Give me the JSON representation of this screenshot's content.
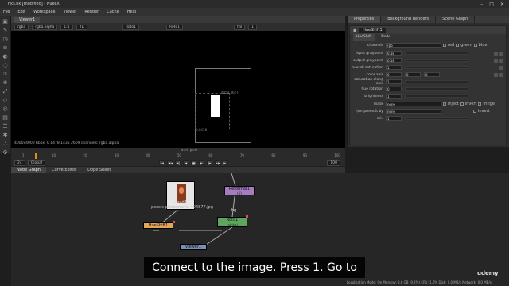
{
  "window": {
    "title": "nks.nk [modified] - NukeX",
    "controls": [
      "–",
      "□",
      "✕"
    ]
  },
  "menu": [
    "File",
    "Edit",
    "Workspace",
    "Viewer",
    "Render",
    "Cache",
    "Help"
  ],
  "viewer": {
    "tab_label": "Viewer1",
    "channels": "rgba",
    "channel_alpha": "rgba.alpha",
    "zoom": "1:1",
    "proxy": "2D",
    "input_a": "Roto1",
    "input_b": "Roto1",
    "gain": "f/8",
    "gamma": "1",
    "status_line": "4000x4000  bbox: 0 1478 1435 2609 channels: rgba.alpha",
    "coords": "x=0 y=0",
    "bbox_top_label": "4054,4627",
    "bbox_bottom_label": "0,0478"
  },
  "properties": {
    "tabs": [
      "Properties",
      "Background Renders",
      "Scene Graph"
    ],
    "node_name": "HueShift1",
    "node_tab_active": "HueShift",
    "node_tab_other": "Node",
    "rows": [
      {
        "label": "channels",
        "value": "rgb"
      },
      {
        "label": "input graypoint",
        "value": "0.18"
      },
      {
        "label": "output graypoint",
        "value": "0.18"
      },
      {
        "label": "overall saturation",
        "value": "1"
      },
      {
        "label": "color axis",
        "value": "0"
      },
      {
        "label": "saturation along axis",
        "value": "1"
      },
      {
        "label": "hue rotation",
        "value": "0"
      },
      {
        "label": "brightness",
        "value": "1"
      },
      {
        "label": "mask",
        "value": "none"
      },
      {
        "label": "(un)premult by",
        "value": "none"
      },
      {
        "label": "mix",
        "value": "1"
      }
    ],
    "channel_checks": [
      "red",
      "green",
      "blue"
    ],
    "mask_opts": [
      "inject",
      "invert",
      "fringe"
    ],
    "premult_opt": "invert"
  },
  "timeline": {
    "ticks": [
      "1",
      "10",
      "20",
      "30",
      "40",
      "50",
      "60",
      "70",
      "80",
      "90",
      "100"
    ],
    "current_frame": "24",
    "fps_label": "Global",
    "end_frame": "100",
    "buttons": [
      "|◀",
      "◀◀",
      "◀|",
      "◀",
      "■",
      "▶",
      "|▶",
      "▶▶",
      "▶|"
    ]
  },
  "dag": {
    "tabs": [
      "Node Graph",
      "Curve Editor",
      "Dope Sheet"
    ],
    "nodes": {
      "read": {
        "label": "Read1",
        "sub": "pexels-photomania-494877.jpg"
      },
      "reformat": {
        "label": "Reformat1",
        "sub": "(1)"
      },
      "roto": {
        "label": "Roto1",
        "sub": "(alpha)"
      },
      "hueshift": {
        "label": "HueShift1"
      },
      "viewer": {
        "label": "Viewer1"
      }
    },
    "input_labels": {
      "bg": "bg"
    }
  },
  "caption": "Connect to the image. Press 1. Go to",
  "statusbar": "Localisation Mode: On  Memory: 3.6 GB (9.2%)  CPU: 1.6%  Disk: 0.0 MB/s  Network: 0.0 MB/s",
  "watermark": "udemy",
  "colors": {
    "hueshift_node": "#e3a558",
    "roto_node": "#5ea55e",
    "reformat_node": "#a77bbf",
    "viewer_node": "#7a90b6",
    "playhead": "#e08a1e"
  }
}
